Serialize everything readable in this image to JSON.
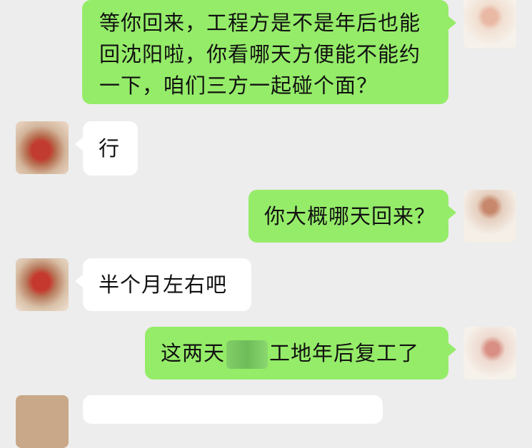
{
  "messages": [
    {
      "side": "right",
      "lines": [
        "等你回来，工程方是不是年后也能",
        "回沈阳啦，你看哪天方便能不能约",
        "一下，咱们三方一起碰个面？"
      ]
    },
    {
      "side": "left",
      "text": "行"
    },
    {
      "side": "right",
      "text": "你大概哪天回来？"
    },
    {
      "side": "left",
      "text": "半个月左右吧"
    },
    {
      "side": "right",
      "text_before": "这两天",
      "text_after": "工地年后复工了"
    }
  ],
  "colors": {
    "background": "#ededed",
    "sent_bubble": "#95ec69",
    "received_bubble": "#ffffff"
  }
}
